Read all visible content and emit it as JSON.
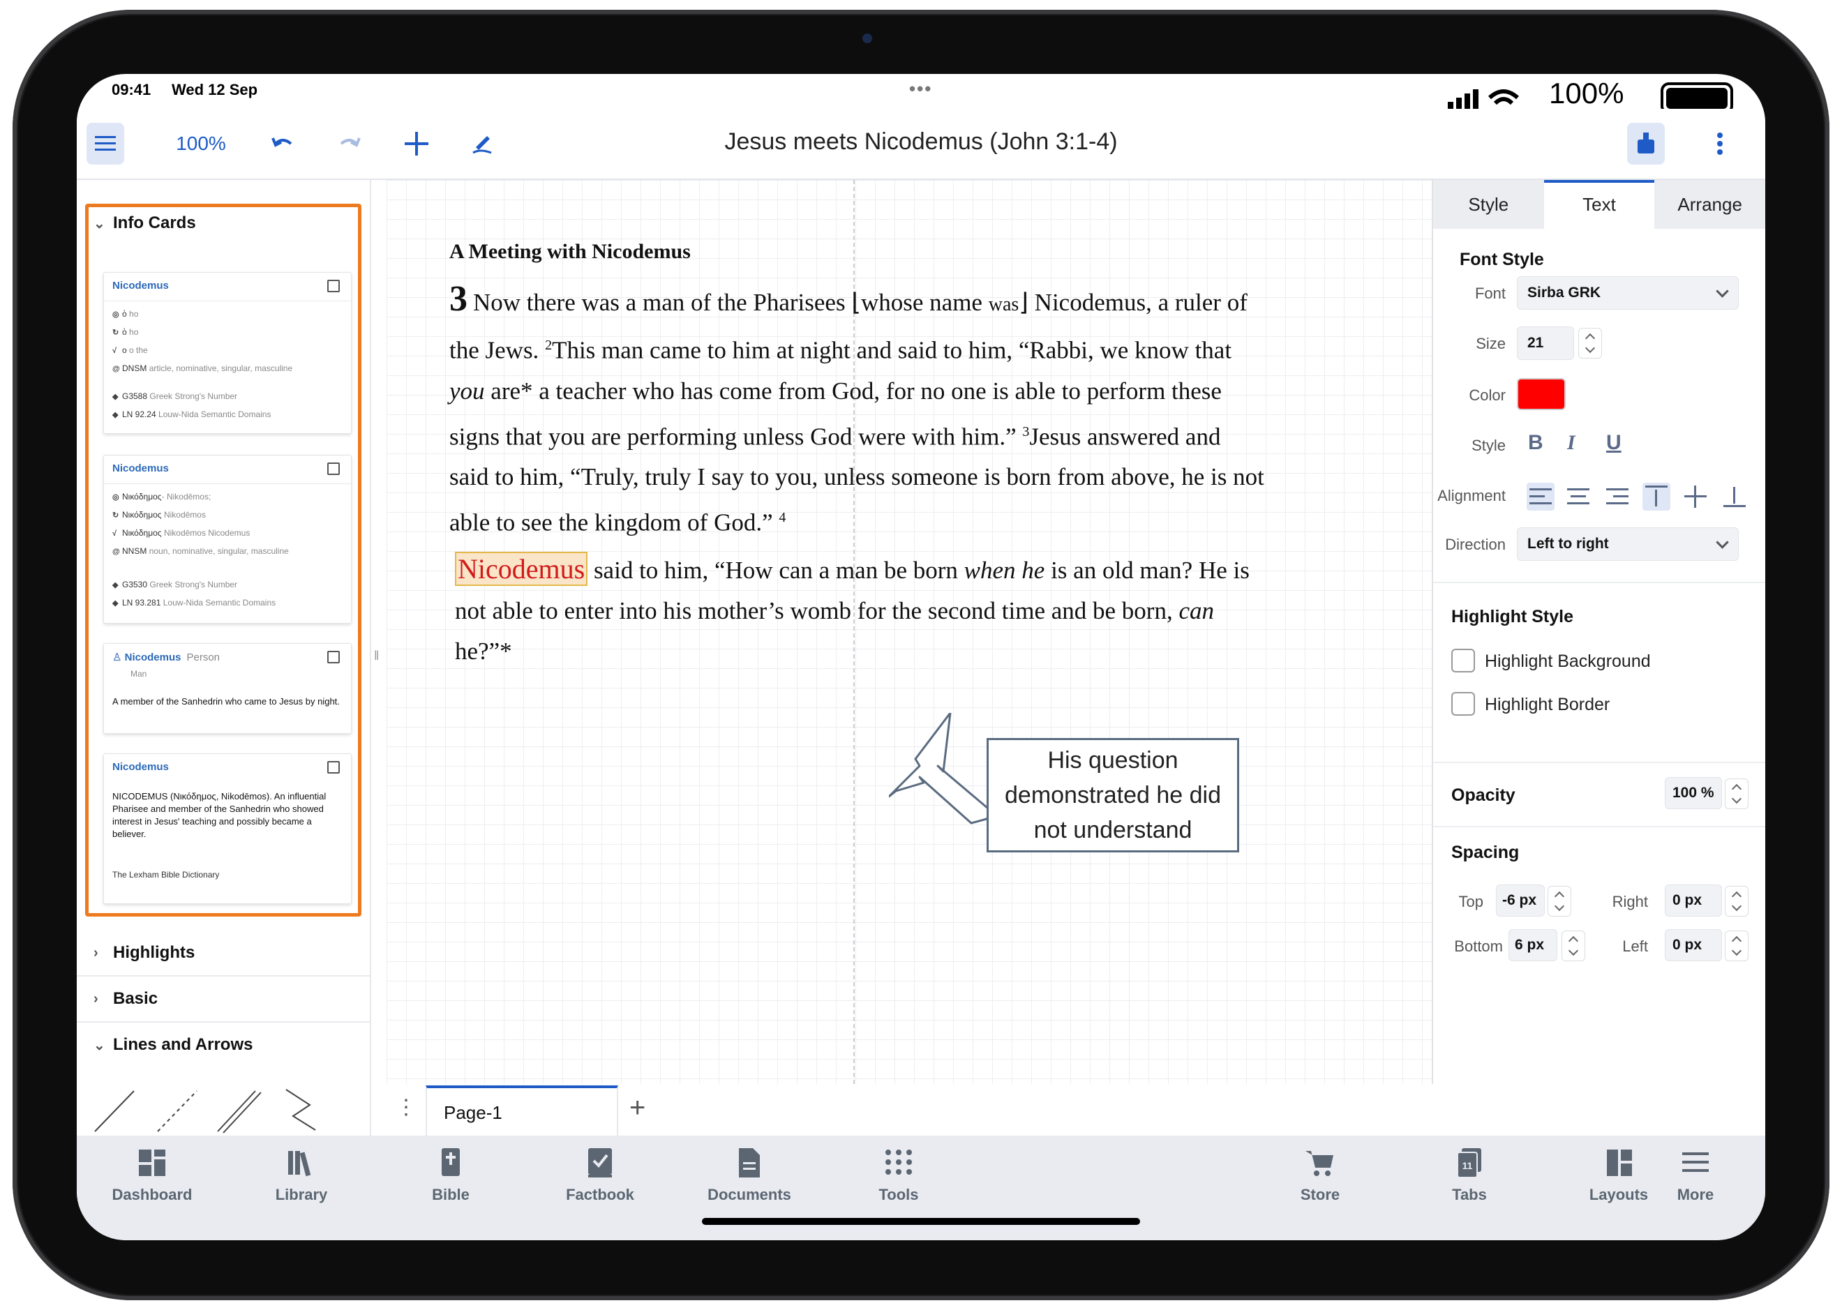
{
  "status": {
    "time": "09:41",
    "date": "Wed 12 Sep",
    "battery": "100%"
  },
  "toolbar": {
    "zoom": "100%",
    "title": "Jesus meets Nicodemus (John 3:1-4)"
  },
  "left_panel": {
    "sections": {
      "info_cards": "Info Cards",
      "highlights": "Highlights",
      "basic": "Basic",
      "lines_arrows": "Lines and Arrows"
    },
    "cards": [
      {
        "title": "Nicodemus",
        "rows": [
          {
            "icon": "circle-icon",
            "text": "ὁ",
            "sub": "ho"
          },
          {
            "icon": "refresh-icon",
            "text": "ὁ",
            "sub": "ho"
          },
          {
            "icon": "root-icon",
            "text": "ο",
            "sub": "o the"
          },
          {
            "icon": "at-icon",
            "text": "DNSM",
            "sub": "article, nominative, singular, masculine"
          },
          {
            "icon": "diamond-icon",
            "text": "G3588",
            "sub": "Greek Strong's Number"
          },
          {
            "icon": "diamond-icon",
            "text": "LN 92.24",
            "sub": "Louw-Nida Semantic Domains"
          }
        ]
      },
      {
        "title": "Nicodemus",
        "rows": [
          {
            "icon": "circle-icon",
            "text": "Νικόδημος·",
            "sub": "Nikodēmos;"
          },
          {
            "icon": "refresh-icon",
            "text": "Νικόδημος",
            "sub": "Nikodēmos"
          },
          {
            "icon": "root-icon",
            "text": "Νικόδημος",
            "sub": "Nikodēmos Nicodemus"
          },
          {
            "icon": "at-icon",
            "text": "NNSM",
            "sub": "noun, nominative, singular, masculine"
          },
          {
            "icon": "diamond-icon",
            "text": "G3530",
            "sub": "Greek Strong's Number"
          },
          {
            "icon": "diamond-icon",
            "text": "LN 93.281",
            "sub": "Louw-Nida Semantic Domains"
          }
        ]
      },
      {
        "title": "Nicodemus",
        "subtitle": "Person",
        "line2": "Man",
        "body": "A member of the Sanhedrin who came to Jesus by night."
      },
      {
        "title": "Nicodemus",
        "body": "NICODEMUS (Νικόδημος, Nikodēmos). An influential Pharisee and member of the Sanhedrin who showed interest in Jesus' teaching and possibly became a believer.",
        "source": "The Lexham Bible Dictionary"
      }
    ]
  },
  "canvas": {
    "heading": "A Meeting with Nicodemus",
    "chapter": "3",
    "verse1_a": "Now there was a man of the Pharisees ⌊whose name ",
    "verse1_was": "was",
    "verse1_b": "⌋ Nicodemus, a ruler of the Jews. ",
    "v2": "2",
    "verse2_a": "This man came to him at night and said to him, “Rabbi, we know that ",
    "verse2_you": "you",
    "verse2_b": " are* a teacher who has come from God, for no one is able to perform these signs that you are performing unless God were with him.” ",
    "v3": "3",
    "verse3": "Jesus answered and said to him, “Truly, truly I say to you, unless someone is born from above, he is not able to see the kingdom of God.” ",
    "v4": "4",
    "nicodemus": "Nicodemus",
    "verse4_a": " said to him, “How can a man be born ",
    "verse4_when": "when he",
    "verse4_b": " is an old man? He is not able to enter into his mother’s womb for the second time and be born, ",
    "verse4_can": "can",
    "verse4_c": " he?”*",
    "callout": "His question demonstrated he did not understand"
  },
  "page_tabs": {
    "active": "Page-1"
  },
  "right_panel": {
    "tabs": [
      "Style",
      "Text",
      "Arrange"
    ],
    "active_tab": "Text",
    "font_style": "Font Style",
    "font_label": "Font",
    "font_value": "Sirba GRK",
    "size_label": "Size",
    "size_value": "21",
    "color_label": "Color",
    "color_value": "#ff0000",
    "style_label": "Style",
    "alignment_label": "Alignment",
    "direction_label": "Direction",
    "direction_value": "Left to right",
    "highlight_style": "Highlight Style",
    "highlight_background": "Highlight Background",
    "highlight_border": "Highlight Border",
    "opacity_label": "Opacity",
    "opacity_value": "100 %",
    "spacing_label": "Spacing",
    "top_label": "Top",
    "top_value": "-6 px",
    "right_label": "Right",
    "right_value": "0 px",
    "bottom_label": "Bottom",
    "bottom_value": "6 px",
    "left_label": "Left",
    "left_value": "0 px"
  },
  "bottom_nav": [
    {
      "label": "Dashboard",
      "icon": "dashboard-icon"
    },
    {
      "label": "Library",
      "icon": "library-icon"
    },
    {
      "label": "Bible",
      "icon": "bible-icon"
    },
    {
      "label": "Factbook",
      "icon": "factbook-icon"
    },
    {
      "label": "Documents",
      "icon": "documents-icon"
    },
    {
      "label": "Tools",
      "icon": "tools-icon"
    },
    {
      "label": "Store",
      "icon": "store-icon"
    },
    {
      "label": "Tabs",
      "icon": "tabs-icon",
      "badge": "11"
    },
    {
      "label": "Layouts",
      "icon": "layouts-icon"
    },
    {
      "label": "More",
      "icon": "more-icon"
    }
  ],
  "colors": {
    "accent": "#1e5bc6",
    "orange_border": "#ed7a1e",
    "highlight_red": "#d11b1b"
  }
}
